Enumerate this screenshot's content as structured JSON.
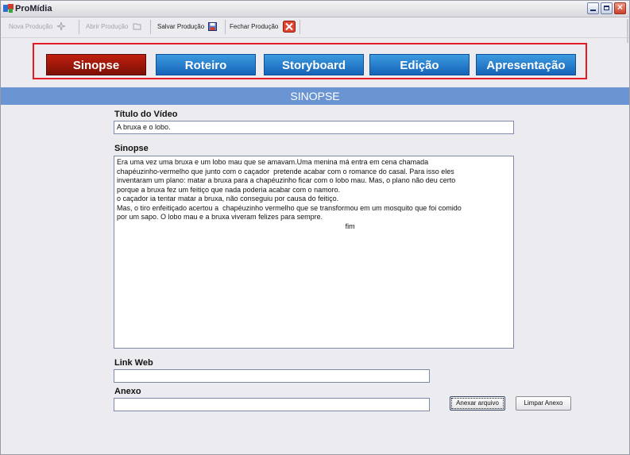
{
  "window": {
    "title": "ProMídia"
  },
  "toolbar": {
    "items": [
      {
        "label": "Nova Produção",
        "icon": "sparkle-new-icon",
        "enabled": false
      },
      {
        "label": "Abrir Produção",
        "icon": "folder-open-icon",
        "enabled": false
      },
      {
        "label": "Salvar Produção",
        "icon": "save-icon",
        "enabled": true
      },
      {
        "label": "Fechar Produção",
        "icon": "close-icon",
        "enabled": true
      }
    ]
  },
  "tabs": [
    {
      "label": "Sinopse",
      "active": true
    },
    {
      "label": "Roteiro",
      "active": false
    },
    {
      "label": "Storyboard",
      "active": false
    },
    {
      "label": "Edição",
      "active": false
    },
    {
      "label": "Apresentação",
      "active": false
    }
  ],
  "section": {
    "title": "SINOPSE"
  },
  "form": {
    "titulo_label": "Título do Vídeo",
    "titulo_value": "A bruxa e o lobo.",
    "sinopse_label": "Sinopse",
    "sinopse_value": "Era uma vez uma bruxa e um lobo mau que se amavam.Uma menina má entra em cena chamada\nchapéuzinho-vermelho que junto com o caçador  pretende acabar com o romance do casal. Para isso eles\ninventaram um plano: matar a bruxa para a chapéuzinho ficar com o lobo mau. Mas, o plano não deu certo\nporque a bruxa fez um feitiço que nada poderia acabar com o namoro.\no caçador ia tentar matar a bruxa, não conseguiu por causa do feitiço.\nMas, o tiro enfeitiçado acertou a  chapéuzinho vermelho que se transformou em um mosquito que foi comido\npor um sapo. O lobo mau e a bruxa viveram felizes para sempre.\n                                                                                                                   fim",
    "link_label": "Link Web",
    "link_value": "",
    "anexo_label": "Anexo",
    "anexo_value": "",
    "anexar_button": "Anexar arquivo",
    "limpar_button": "Limpar Anexo"
  },
  "colors": {
    "tab_active": "#a0180a",
    "tab_inactive": "#2a7fd0",
    "nav_frame": "#e31b22",
    "section_bar": "#6a94d2"
  }
}
